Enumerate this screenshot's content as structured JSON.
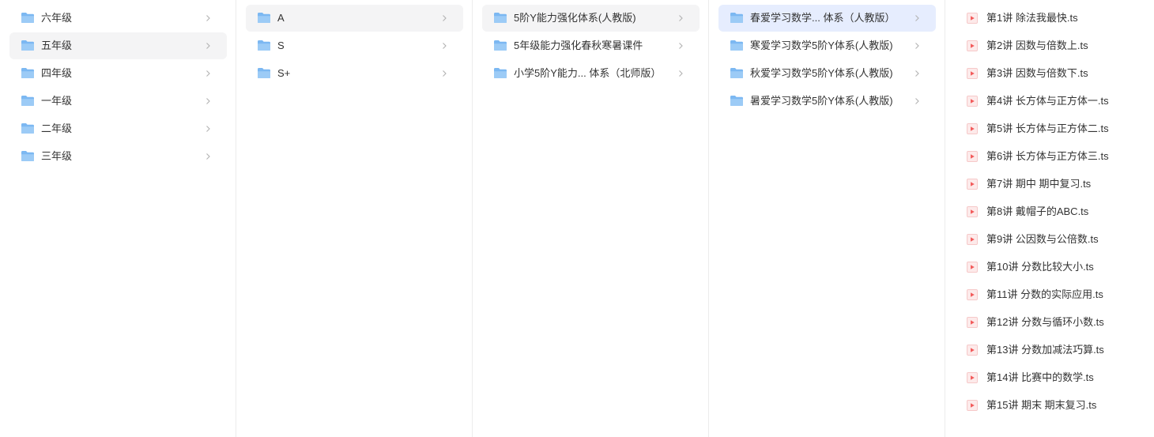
{
  "columns": [
    {
      "items": [
        {
          "label": "六年级",
          "type": "folder",
          "state": "normal",
          "icon": "folder-icon"
        },
        {
          "label": "五年级",
          "type": "folder",
          "state": "selected",
          "icon": "folder-icon"
        },
        {
          "label": "四年级",
          "type": "folder",
          "state": "normal",
          "icon": "folder-icon"
        },
        {
          "label": "一年级",
          "type": "folder",
          "state": "normal",
          "icon": "folder-icon"
        },
        {
          "label": "二年级",
          "type": "folder",
          "state": "normal",
          "icon": "folder-icon"
        },
        {
          "label": "三年级",
          "type": "folder",
          "state": "normal",
          "icon": "folder-icon"
        }
      ]
    },
    {
      "items": [
        {
          "label": "A",
          "type": "folder",
          "state": "selected",
          "icon": "folder-icon"
        },
        {
          "label": "S",
          "type": "folder",
          "state": "normal",
          "icon": "folder-icon"
        },
        {
          "label": "S+",
          "type": "folder",
          "state": "normal",
          "icon": "folder-icon"
        }
      ]
    },
    {
      "items": [
        {
          "label": "5阶Y能力强化体系(人教版)",
          "type": "folder",
          "state": "selected",
          "icon": "folder-icon"
        },
        {
          "label": "5年级能力强化春秋寒暑课件",
          "type": "folder",
          "state": "normal",
          "icon": "folder-icon"
        },
        {
          "label": "小学5阶Y能力... 体系（北师版）",
          "type": "folder",
          "state": "normal",
          "icon": "folder-icon"
        }
      ]
    },
    {
      "items": [
        {
          "label": "春爱学习数学... 体系（人教版）",
          "type": "folder",
          "state": "active",
          "icon": "folder-icon"
        },
        {
          "label": "寒爱学习数学5阶Y体系(人教版)",
          "type": "folder",
          "state": "normal",
          "icon": "folder-icon"
        },
        {
          "label": "秋爱学习数学5阶Y体系(人教版)",
          "type": "folder",
          "state": "normal",
          "icon": "folder-icon"
        },
        {
          "label": "暑爱学习数学5阶Y体系(人教版)",
          "type": "folder",
          "state": "normal",
          "icon": "folder-icon"
        }
      ]
    },
    {
      "items": [
        {
          "label": "第1讲 除法我最快.ts",
          "type": "video",
          "icon": "video-file-icon"
        },
        {
          "label": "第2讲 因数与倍数上.ts",
          "type": "video",
          "icon": "video-file-icon"
        },
        {
          "label": "第3讲 因数与倍数下.ts",
          "type": "video",
          "icon": "video-file-icon"
        },
        {
          "label": "第4讲 长方体与正方体一.ts",
          "type": "video",
          "icon": "video-file-icon"
        },
        {
          "label": "第5讲 长方体与正方体二.ts",
          "type": "video",
          "icon": "video-file-icon"
        },
        {
          "label": "第6讲 长方体与正方体三.ts",
          "type": "video",
          "icon": "video-file-icon"
        },
        {
          "label": "第7讲 期中  期中复习.ts",
          "type": "video",
          "icon": "video-file-icon"
        },
        {
          "label": "第8讲 戴帽子的ABC.ts",
          "type": "video",
          "icon": "video-file-icon"
        },
        {
          "label": "第9讲 公因数与公倍数.ts",
          "type": "video",
          "icon": "video-file-icon"
        },
        {
          "label": "第10讲 分数比较大小.ts",
          "type": "video",
          "icon": "video-file-icon"
        },
        {
          "label": "第11讲 分数的实际应用.ts",
          "type": "video",
          "icon": "video-file-icon"
        },
        {
          "label": "第12讲 分数与循环小数.ts",
          "type": "video",
          "icon": "video-file-icon"
        },
        {
          "label": "第13讲 分数加减法巧算.ts",
          "type": "video",
          "icon": "video-file-icon"
        },
        {
          "label": "第14讲 比赛中的数学.ts",
          "type": "video",
          "icon": "video-file-icon"
        },
        {
          "label": "第15讲 期末  期末复习.ts",
          "type": "video",
          "icon": "video-file-icon"
        }
      ]
    }
  ],
  "colors": {
    "selected_bg": "#f4f4f5",
    "active_bg": "#e6edfe",
    "text": "#333333",
    "folder": "#7cb8f2",
    "video": "#f25c5c",
    "chevron": "#b3b3b3",
    "divider": "#ececec"
  }
}
